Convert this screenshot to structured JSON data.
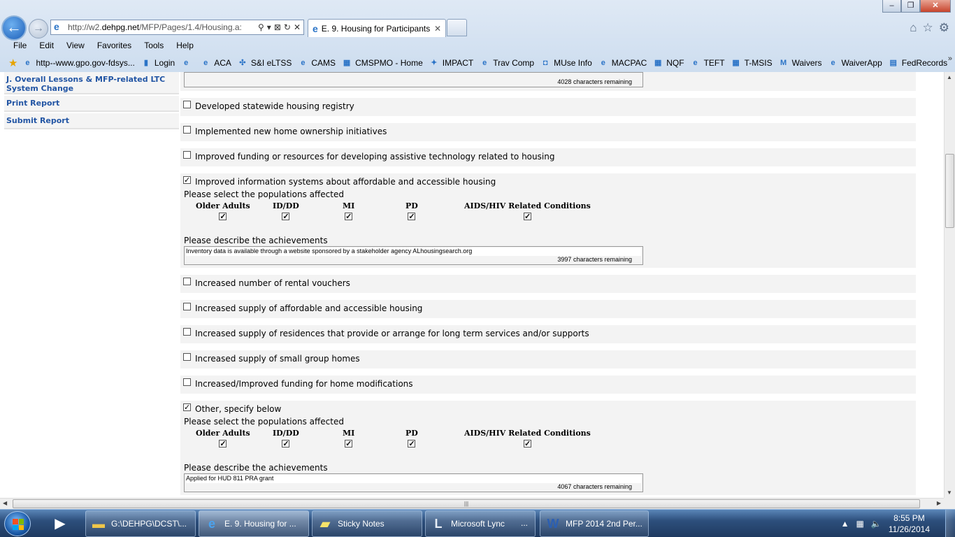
{
  "browser": {
    "url_prefix": "http://w2.",
    "url_host": "dehpg.net",
    "url_rest": "/MFP/Pages/1.4/Housing.a:",
    "tab_title": "E. 9. Housing for Participants",
    "menu": [
      "File",
      "Edit",
      "View",
      "Favorites",
      "Tools",
      "Help"
    ],
    "favorites": [
      {
        "label": "http--www.gpo.gov-fdsys...",
        "icon": "ie-page-icon"
      },
      {
        "label": "Login",
        "icon": "bars-icon"
      },
      {
        "label": "",
        "icon": "ie-page-icon"
      },
      {
        "label": "ACA",
        "icon": "ie-page-icon"
      },
      {
        "label": "S&I eLTSS",
        "icon": "network-icon"
      },
      {
        "label": "CAMS",
        "icon": "ie-page-icon"
      },
      {
        "label": "CMSPMO - Home",
        "icon": "grid-icon"
      },
      {
        "label": "IMPACT",
        "icon": "eagle-icon"
      },
      {
        "label": "Trav Comp",
        "icon": "ie-page-icon"
      },
      {
        "label": "MUse Info",
        "icon": "cdc-icon"
      },
      {
        "label": "MACPAC",
        "icon": "ie-page-icon"
      },
      {
        "label": "NQF",
        "icon": "grid-icon"
      },
      {
        "label": "TEFT",
        "icon": "ie-page-icon"
      },
      {
        "label": "T-MSIS",
        "icon": "grid-icon"
      },
      {
        "label": "Waivers",
        "icon": "m-icon"
      },
      {
        "label": "WaiverApp",
        "icon": "ie-page-icon"
      },
      {
        "label": "FedRecords",
        "icon": "doc-icon"
      }
    ]
  },
  "sidebar": {
    "items": [
      {
        "label": "J. Overall Lessons & MFP-related LTC System Change"
      },
      {
        "label": "Print Report"
      },
      {
        "label": "Submit Report"
      }
    ]
  },
  "form": {
    "top_remaining": "4028",
    "remaining_suffix": "characters remaining",
    "populations_prompt": "Please select the populations affected",
    "achievements_prompt": "Please describe the achievements",
    "population_labels": [
      "Older Adults",
      "ID/DD",
      "MI",
      "PD",
      "AIDS/HIV Related Conditions"
    ],
    "items": [
      {
        "label": "Developed statewide housing registry",
        "checked": false
      },
      {
        "label": "Implemented new home ownership initiatives",
        "checked": false
      },
      {
        "label": "Improved funding or resources for developing assistive technology related to housing",
        "checked": false
      },
      {
        "label": "Improved information systems about affordable and accessible housing",
        "checked": true,
        "populations": [
          true,
          true,
          true,
          true,
          true
        ],
        "achievement": "Inventory data is available through a website sponsored by a stakeholder agency ALhousingsearch.org",
        "remaining": "3997"
      },
      {
        "label": "Increased number of rental vouchers",
        "checked": false
      },
      {
        "label": "Increased supply of affordable and accessible housing",
        "checked": false
      },
      {
        "label": "Increased supply of residences that provide or arrange for long term services and/or supports",
        "checked": false
      },
      {
        "label": "Increased supply of small group homes",
        "checked": false
      },
      {
        "label": "Increased/Improved funding for home modifications",
        "checked": false
      },
      {
        "label": "Other, specify below",
        "checked": true,
        "populations": [
          true,
          true,
          true,
          true,
          true
        ],
        "achievement": "Applied for HUD 811 PRA grant",
        "remaining": "4067"
      }
    ]
  },
  "taskbar": {
    "items": [
      {
        "label": "G:\\DEHPG\\DCST\\...",
        "icon": "folder-icon"
      },
      {
        "label": "E. 9. Housing for ...",
        "icon": "ie-icon"
      },
      {
        "label": "Sticky Notes",
        "icon": "sticky-notes-icon"
      },
      {
        "label": "Microsoft Lync",
        "icon": "lync-icon"
      },
      {
        "label": "...",
        "icon": ""
      },
      {
        "label": "MFP 2014 2nd Per...",
        "icon": "word-icon"
      }
    ],
    "time": "8:55 PM",
    "date": "11/26/2014"
  }
}
